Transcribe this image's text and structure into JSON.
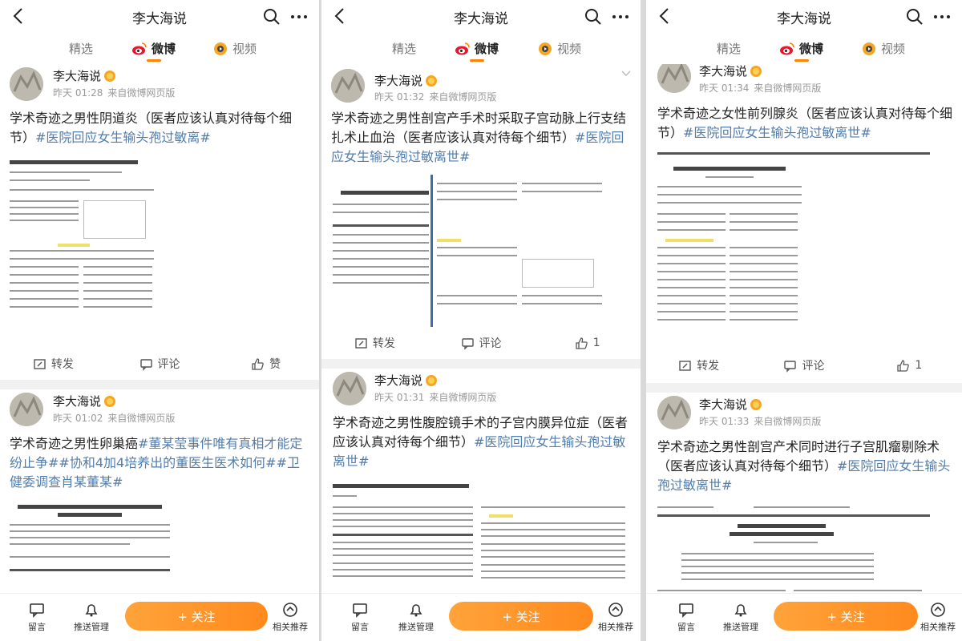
{
  "colors": {
    "accent": "#ff8200",
    "topic": "#507daf",
    "follow_button": "#ff9a2e"
  },
  "panels": [
    {
      "nav": {
        "title": "李大海说"
      },
      "tabs": {
        "featured": "精选",
        "weibo": "微博",
        "video": "视频"
      },
      "posts": [
        {
          "author": "李大海说",
          "time": "昨天 01:28",
          "source": "来自微博网页版",
          "text": "学术奇迹之男性阴道炎（医者应该认真对待每个细节）",
          "topic": "#医院回应女生输头孢过敏离#",
          "actions": {
            "repost": "转发",
            "comment": "评论",
            "like": "赞"
          }
        },
        {
          "author": "李大海说",
          "time": "昨天 01:02",
          "source": "来自微博网页版",
          "text": "学术奇迹之男性卵巢癌",
          "topic": "#董某莹事件唯有真相才能定纷止争##协和4加4培养出的董医生医术如何##卫健委调查肖某董某#"
        }
      ],
      "bottom": {
        "message": "留言",
        "push": "推送管理",
        "follow": "+ 关注",
        "related": "相关推荐"
      }
    },
    {
      "nav": {
        "title": "李大海说"
      },
      "tabs": {
        "featured": "精选",
        "weibo": "微博",
        "video": "视频"
      },
      "posts": [
        {
          "author": "李大海说",
          "time": "昨天 01:32",
          "source": "来自微博网页版",
          "text": "学术奇迹之男性剖宫产手术时采取子宫动脉上行支结扎术止血治（医者应该认真对待每个细节）",
          "topic": "#医院回应女生输头孢过敏离世#",
          "actions": {
            "repost": "转发",
            "comment": "评论",
            "like": "1"
          }
        },
        {
          "author": "李大海说",
          "time": "昨天 01:31",
          "source": "来自微博网页版",
          "text": "学术奇迹之男性腹腔镜手术的子宫内膜异位症（医者应该认真对待每个细节）",
          "topic": "#医院回应女生输头孢过敏离世#"
        }
      ],
      "bottom": {
        "message": "留言",
        "push": "推送管理",
        "follow": "+ 关注",
        "related": "相关推荐"
      }
    },
    {
      "nav": {
        "title": "李大海说"
      },
      "tabs": {
        "featured": "精选",
        "weibo": "微博",
        "video": "视频"
      },
      "posts": [
        {
          "author": "李大海说",
          "time": "昨天 01:34",
          "source": "来自微博网页版",
          "text": "学术奇迹之女性前列腺炎（医者应该认真对待每个细节）",
          "topic": "#医院回应女生输头孢过敏离世#",
          "actions": {
            "repost": "转发",
            "comment": "评论",
            "like": "1"
          }
        },
        {
          "author": "李大海说",
          "time": "昨天 01:33",
          "source": "来自微博网页版",
          "text": "学术奇迹之男性剖宫产术同时进行子宫肌瘤剔除术（医者应该认真对待每个细节）",
          "topic": "#医院回应女生输头孢过敏离世#"
        }
      ],
      "bottom": {
        "message": "留言",
        "push": "推送管理",
        "follow": "+ 关注",
        "related": "相关推荐"
      }
    }
  ],
  "icons": [
    "back-icon",
    "search-icon",
    "more-icon",
    "weibo-icon",
    "video-icon",
    "repost-icon",
    "comment-icon",
    "like-icon",
    "message-icon",
    "push-icon",
    "related-icon",
    "verified-icon"
  ]
}
